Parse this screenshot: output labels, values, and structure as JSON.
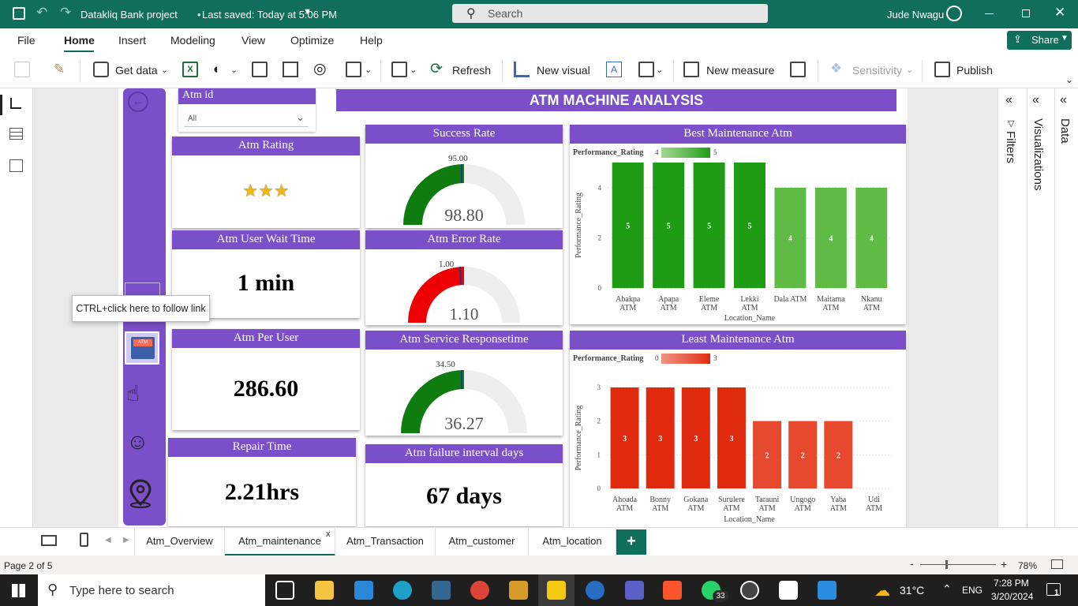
{
  "titlebar": {
    "title": "Datakliq Bank project",
    "saved": "Last saved: Today at 5:06 PM",
    "search": "Search",
    "user": "Jude Nwagu"
  },
  "menu": {
    "items": [
      "File",
      "Home",
      "Insert",
      "Modeling",
      "View",
      "Optimize",
      "Help"
    ],
    "share": "Share"
  },
  "ribbon": {
    "get_data": "Get data",
    "refresh": "Refresh",
    "new_visual": "New visual",
    "new_measure": "New measure",
    "sensitivity": "Sensitivity",
    "publish": "Publish"
  },
  "rightpanes": {
    "filters": "Filters",
    "visualizations": "Visualizations",
    "data": "Data"
  },
  "report": {
    "title": "ATM MACHINE ANALYSIS",
    "slicer": {
      "label": "Atm id",
      "value": "All"
    },
    "tooltip": "CTRL+click here to follow link",
    "cards": {
      "rating": {
        "title": "Atm Rating",
        "stars": "★★★"
      },
      "wait": {
        "title": "Atm User Wait Time",
        "value": "1 min"
      },
      "per_user": {
        "title": "Atm Per User",
        "value": "286.60"
      },
      "repair": {
        "title": "Repair Time",
        "value": "2.21hrs"
      },
      "failure": {
        "title": "Atm failure interval days",
        "value": "67 days"
      }
    },
    "gauges": {
      "success": {
        "title": "Success Rate",
        "target": "95.00",
        "value": "98.80"
      },
      "error": {
        "title": "Atm Error Rate",
        "target": "1.00",
        "value": "1.10"
      },
      "service": {
        "title": "Atm Service Responsetime",
        "target": "34.50",
        "value": "36.27"
      }
    }
  },
  "chart_data": [
    {
      "type": "bar",
      "title": "Best Maintenance Atm",
      "xlabel": "Location_Name",
      "ylabel": "Performance_Rating",
      "legend_title": "Performance_Rating",
      "legend_min": "4",
      "legend_max": "5",
      "categories": [
        [
          "Abakpa",
          "ATM"
        ],
        [
          "Apapa",
          "ATM"
        ],
        [
          "Eleme",
          "ATM"
        ],
        [
          "Lekki",
          "ATM"
        ],
        [
          "Dala ATM"
        ],
        [
          "Maitama",
          "ATM"
        ],
        [
          "Nkanu",
          "ATM"
        ]
      ],
      "values": [
        5,
        5,
        5,
        5,
        4,
        4,
        4
      ],
      "yticks": [
        "0",
        "2",
        "4"
      ],
      "ylim": [
        0,
        5
      ],
      "colors": {
        "high": "#1e9c14",
        "low": "#5fba46"
      }
    },
    {
      "type": "bar",
      "title": "Least Maintenance Atm",
      "xlabel": "Location_Name",
      "ylabel": "Performance_Rating",
      "legend_title": "Performance_Rating",
      "legend_min": "0",
      "legend_max": "3",
      "categories": [
        [
          "Ahoada",
          "ATM"
        ],
        [
          "Bonny",
          "ATM"
        ],
        [
          "Gokana",
          "ATM"
        ],
        [
          "Surulere",
          "ATM"
        ],
        [
          "Tarauni",
          "ATM"
        ],
        [
          "Ungogo",
          "ATM"
        ],
        [
          "Yaba",
          "ATM"
        ],
        [
          "Udi",
          "ATM"
        ]
      ],
      "values": [
        3,
        3,
        3,
        3,
        2,
        2,
        2,
        0
      ],
      "yticks": [
        "0",
        "1",
        "2",
        "3"
      ],
      "ylim": [
        0,
        3
      ],
      "colors": {
        "high": "#e02a10",
        "low": "#e6492d"
      }
    }
  ],
  "tabs": [
    "Atm_Overview",
    "Atm_maintenance",
    "Atm_Transaction",
    "Atm_customer",
    "Atm_location"
  ],
  "status": {
    "page": "Page 2 of 5",
    "zoom": "78%"
  },
  "taskbar": {
    "search": "Type here to search",
    "weather": "31°C",
    "lang": "ENG",
    "time": "7:28 PM",
    "date": "3/20/2024",
    "whatsapp_badge": "33",
    "notif_badge": "1"
  }
}
